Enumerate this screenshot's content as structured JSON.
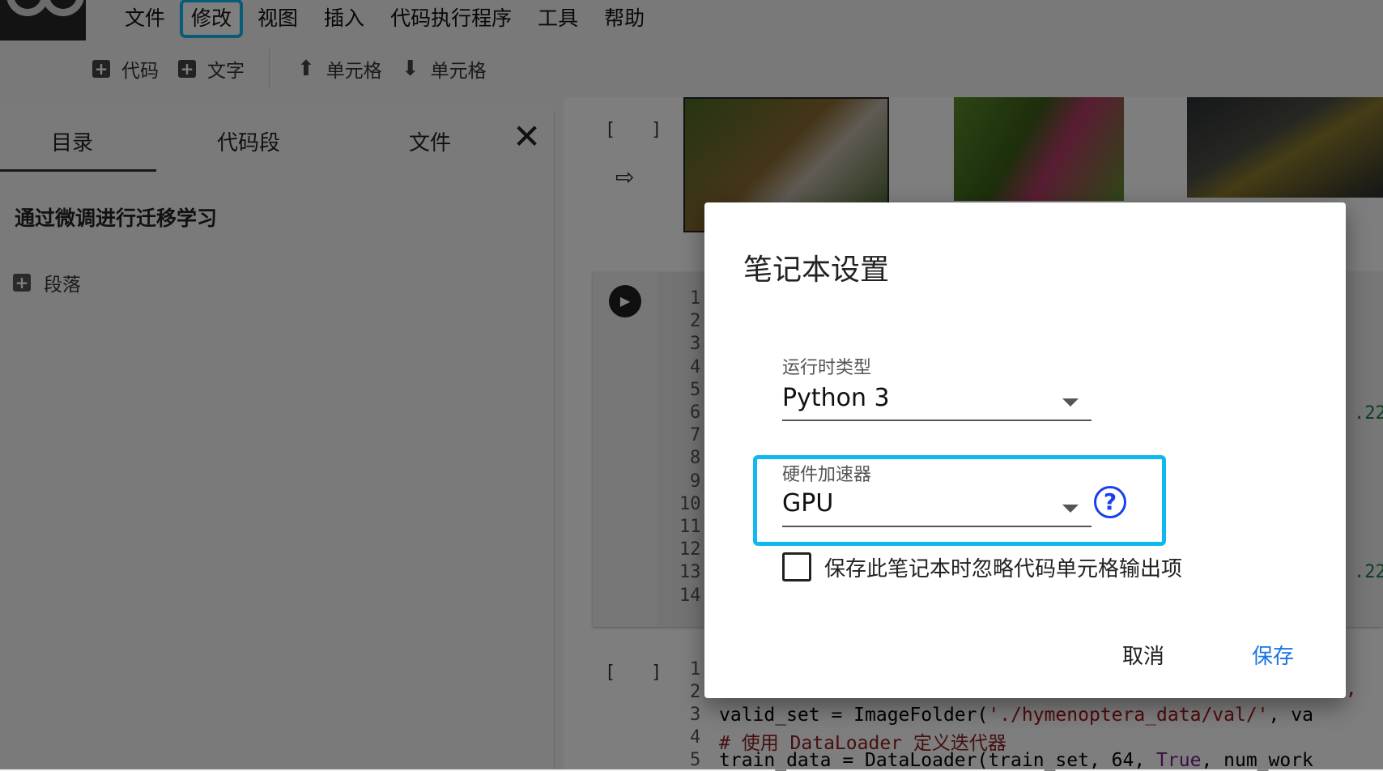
{
  "menubar": {
    "items": [
      "文件",
      "修改",
      "视图",
      "插入",
      "代码执行程序",
      "工具",
      "帮助"
    ],
    "highlighted_index": 1
  },
  "toolbar": {
    "add_code": "代码",
    "add_text": "文字",
    "cell_up": "单元格",
    "cell_down": "单元格"
  },
  "sidebar": {
    "tabs": [
      "目录",
      "代码段",
      "文件"
    ],
    "active_tab": "目录",
    "toc_title": "通过微调进行迁移学习",
    "section_label": "段落"
  },
  "cells": {
    "empty_brackets": "[ ]",
    "line_numbers": [
      "1",
      "2",
      "3",
      "4",
      "5",
      "6",
      "7",
      "8",
      "9",
      "10",
      "11",
      "12",
      "13",
      "14"
    ],
    "partial_right_values": [
      ".22",
      ".22"
    ],
    "code2_line_numbers": [
      "1",
      "2",
      "3",
      "4",
      "5"
    ],
    "code2": {
      "line3_pre": "valid_set = ImageFolder(",
      "line3_str": "'./hymenoptera_data/val/'",
      "line3_post": ", va",
      "line4_comment": "# 使用 DataLoader 定义迭代器",
      "line5_pre": "train_data = DataLoader(train_set, 64, ",
      "line5_kw": "True",
      "line5_post": ", num_work",
      "line2_tail": "',"
    }
  },
  "dialog": {
    "title": "笔记本设置",
    "runtime_label": "运行时类型",
    "runtime_value": "Python 3",
    "accelerator_label": "硬件加速器",
    "accelerator_value": "GPU",
    "help": "?",
    "checkbox_label": "保存此笔记本时忽略代码单元格输出项",
    "checkbox_checked": false,
    "cancel": "取消",
    "save": "保存"
  },
  "colors": {
    "highlight": "#10b8f0",
    "save_button": "#1a73e8",
    "help_icon": "#1b3ff0"
  }
}
